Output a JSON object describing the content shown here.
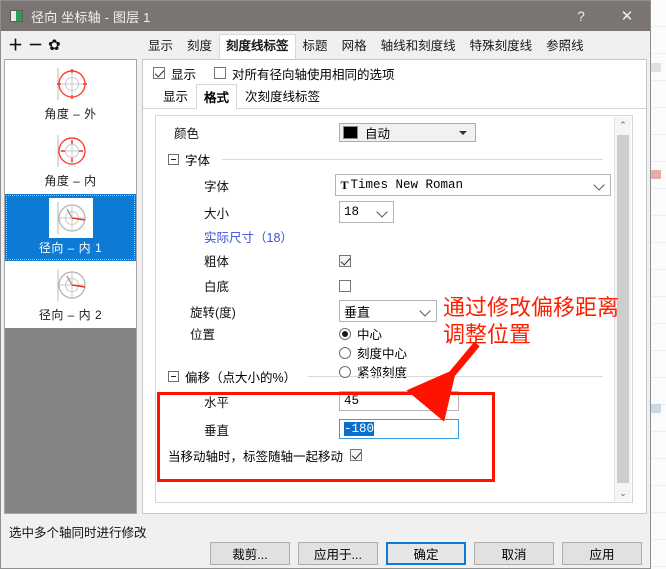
{
  "window": {
    "title": "径向 坐标轴 - 图层 1",
    "icon": "axis-dialog-icon",
    "help_label": "?",
    "close_label": "✕"
  },
  "toolbar": {
    "add_label": "＋",
    "remove_label": "－",
    "settings_label": "✿"
  },
  "tabs": [
    {
      "label": "显示",
      "active": false
    },
    {
      "label": "刻度",
      "active": false
    },
    {
      "label": "刻度线标签",
      "active": true
    },
    {
      "label": "标题",
      "active": false
    },
    {
      "label": "网格",
      "active": false
    },
    {
      "label": "轴线和刻度线",
      "active": false
    },
    {
      "label": "特殊刻度线",
      "active": false
    },
    {
      "label": "参照线",
      "active": false
    }
  ],
  "sidebar": {
    "items": [
      {
        "label": "角度 – 外",
        "icon": "polar-axis-angular-outer-icon",
        "selected": false
      },
      {
        "label": "角度 – 内",
        "icon": "polar-axis-angular-inner-icon",
        "selected": false
      },
      {
        "label": "径向 – 内 1",
        "icon": "polar-axis-radial-inner1-icon",
        "selected": true
      },
      {
        "label": "径向 – 内 2",
        "icon": "polar-axis-radial-inner2-icon",
        "selected": false
      }
    ]
  },
  "panel": {
    "show_checkbox": {
      "label": "显示",
      "checked": true
    },
    "same_options_checkbox": {
      "label": "对所有径向轴使用相同的选项",
      "checked": false
    },
    "subtabs": [
      {
        "label": "显示",
        "active": false
      },
      {
        "label": "格式",
        "active": true
      },
      {
        "label": "次刻度线标签",
        "active": false
      }
    ],
    "color": {
      "label": "颜色",
      "value": "自动",
      "swatch": "#000000"
    },
    "font_group": {
      "title": "字体",
      "font": {
        "label": "字体",
        "value": "Times New Roman"
      },
      "size": {
        "label": "大小",
        "value": "18"
      },
      "actual_size": "实际尺寸（18）",
      "bold": {
        "label": "粗体",
        "checked": true
      },
      "white_bg": {
        "label": "白底",
        "checked": false
      }
    },
    "rotation": {
      "label": "旋转(度)",
      "value": "垂直"
    },
    "position": {
      "label": "位置",
      "options": [
        {
          "label": "中心",
          "selected": true
        },
        {
          "label": "刻度中心",
          "selected": false
        },
        {
          "label": "紧邻刻度",
          "selected": false
        }
      ]
    },
    "offset_group": {
      "title": "偏移（点大小的%）",
      "horizontal": {
        "label": "水平",
        "value": "45"
      },
      "vertical": {
        "label": "垂直",
        "value": "-180",
        "selected_text": true,
        "focused": true
      }
    },
    "move_with_axis": {
      "label": "当移动轴时，标签随轴一起移动",
      "checked": true
    },
    "scrollbar": {
      "up": "⌃",
      "down": "⌄"
    }
  },
  "status_text": "选中多个轴同时进行修改",
  "buttons": [
    {
      "label": "裁剪...",
      "default": false
    },
    {
      "label": "应用于...",
      "default": false
    },
    {
      "label": "确定",
      "default": true
    },
    {
      "label": "取消",
      "default": false
    },
    {
      "label": "应用",
      "default": false
    }
  ],
  "annotation": {
    "line1": "通过修改偏移距离",
    "line2": "调整位置",
    "color": "#ff1e00"
  }
}
